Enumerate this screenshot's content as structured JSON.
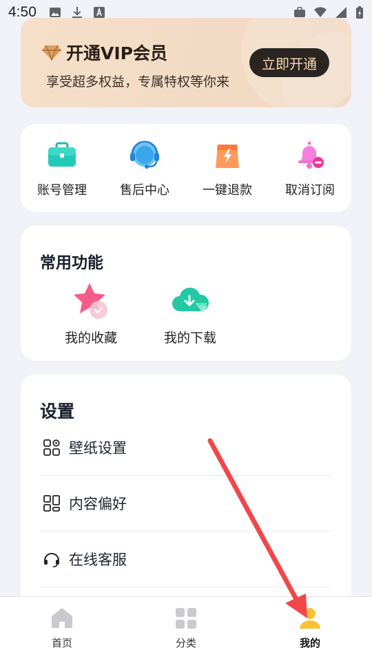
{
  "status_bar": {
    "time": "4:50"
  },
  "vip": {
    "title": "开通VIP会员",
    "subtitle": "享受超多权益，专属特权等你来",
    "button": "立即开通"
  },
  "quick_actions": [
    {
      "label": "账号管理",
      "icon": "briefcase-icon"
    },
    {
      "label": "售后中心",
      "icon": "headset-icon"
    },
    {
      "label": "一键退款",
      "icon": "refund-bag-icon"
    },
    {
      "label": "取消订阅",
      "icon": "bell-minus-icon"
    }
  ],
  "common": {
    "title": "常用功能",
    "items": [
      {
        "label": "我的收藏",
        "icon": "star-heart-icon"
      },
      {
        "label": "我的下载",
        "icon": "cloud-download-icon"
      }
    ]
  },
  "settings": {
    "title": "设置",
    "items": [
      {
        "label": "壁纸设置",
        "icon": "grid-gear-icon"
      },
      {
        "label": "内容偏好",
        "icon": "layout-icon"
      },
      {
        "label": "在线客服",
        "icon": "headphones-icon"
      }
    ]
  },
  "bottom_nav": [
    {
      "label": "首页",
      "icon": "home-icon",
      "active": false
    },
    {
      "label": "分类",
      "icon": "category-grid-icon",
      "active": false
    },
    {
      "label": "我的",
      "icon": "user-icon",
      "active": true
    }
  ],
  "colors": {
    "accent_yellow": "#f8c234",
    "annotation_red": "#f2474a",
    "teal": "#21c8b5"
  }
}
